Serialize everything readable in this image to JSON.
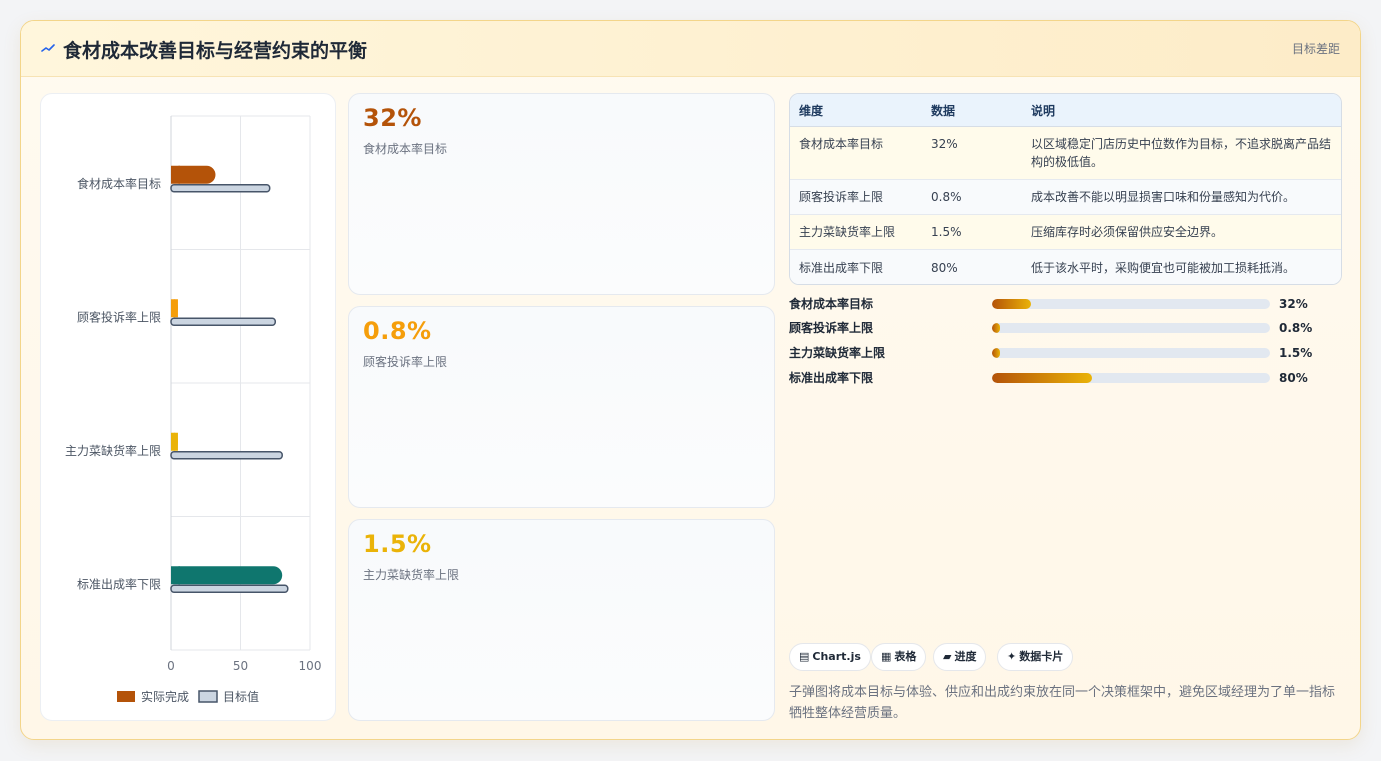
{
  "header": {
    "title": "食材成本改善目标与经营约束的平衡",
    "icon": "trend-icon",
    "tag": "目标差距"
  },
  "colors": {
    "accent_brown": "#b45309",
    "accent_orange": "#f59e0b",
    "accent_yellow": "#eab308",
    "accent_teal": "#0f766e",
    "target_fill": "#cbd5e1",
    "target_stroke": "#475569"
  },
  "chart_data": {
    "type": "bar",
    "orientation": "horizontal",
    "categories": [
      "食材成本率目标",
      "顾客投诉率上限",
      "主力菜缺货率上限",
      "标准出成率下限"
    ],
    "series": [
      {
        "name": "实际完成",
        "values": [
          32,
          5,
          5,
          80
        ],
        "colors": [
          "#b45309",
          "#f59e0b",
          "#eab308",
          "#0f766e"
        ]
      },
      {
        "name": "目标值",
        "values": [
          71,
          75,
          80,
          84
        ],
        "color": "#cbd5e1"
      }
    ],
    "xlim": [
      0,
      100
    ],
    "xticks": [
      "0",
      "50",
      "100"
    ],
    "grid": true,
    "legend": "bottom"
  },
  "stats": [
    {
      "value": "32%",
      "label": "食材成本率目标",
      "color": "#b45309"
    },
    {
      "value": "0.8%",
      "label": "顾客投诉率上限",
      "color": "#f59e0b"
    },
    {
      "value": "1.5%",
      "label": "主力菜缺货率上限",
      "color": "#eab308"
    }
  ],
  "table": {
    "headers": [
      "维度",
      "数据",
      "说明"
    ],
    "rows": [
      [
        "食材成本率目标",
        "32%",
        "以区域稳定门店历史中位数作为目标，不追求脱离产品结构的极低值。"
      ],
      [
        "顾客投诉率上限",
        "0.8%",
        "成本改善不能以明显损害口味和份量感知为代价。"
      ],
      [
        "主力菜缺货率上限",
        "1.5%",
        "压缩库存时必须保留供应安全边界。"
      ],
      [
        "标准出成率下限",
        "80%",
        "低于该水平时，采购便宜也可能被加工损耗抵消。"
      ]
    ]
  },
  "progress": [
    {
      "label": "食材成本率目标",
      "value": "32%",
      "fill_percent": 14
    },
    {
      "label": "顾客投诉率上限",
      "value": "0.8%",
      "fill_percent": 3
    },
    {
      "label": "主力菜缺货率上限",
      "value": "1.5%",
      "fill_percent": 3
    },
    {
      "label": "标准出成率下限",
      "value": "80%",
      "fill_percent": 36
    }
  ],
  "tags": [
    {
      "icon": "chart-icon",
      "glyph": "▤",
      "label": "Chart.js"
    },
    {
      "icon": "table-icon",
      "glyph": "▦",
      "label": "表格"
    },
    {
      "icon": "progress-icon",
      "glyph": "▰",
      "label": "进度"
    },
    {
      "icon": "sparkle-icon",
      "glyph": "✦",
      "label": "数据卡片"
    }
  ],
  "footnote": "子弹图将成本目标与体验、供应和出成约束放在同一个决策框架中，避免区域经理为了单一指标牺牲整体经营质量。"
}
